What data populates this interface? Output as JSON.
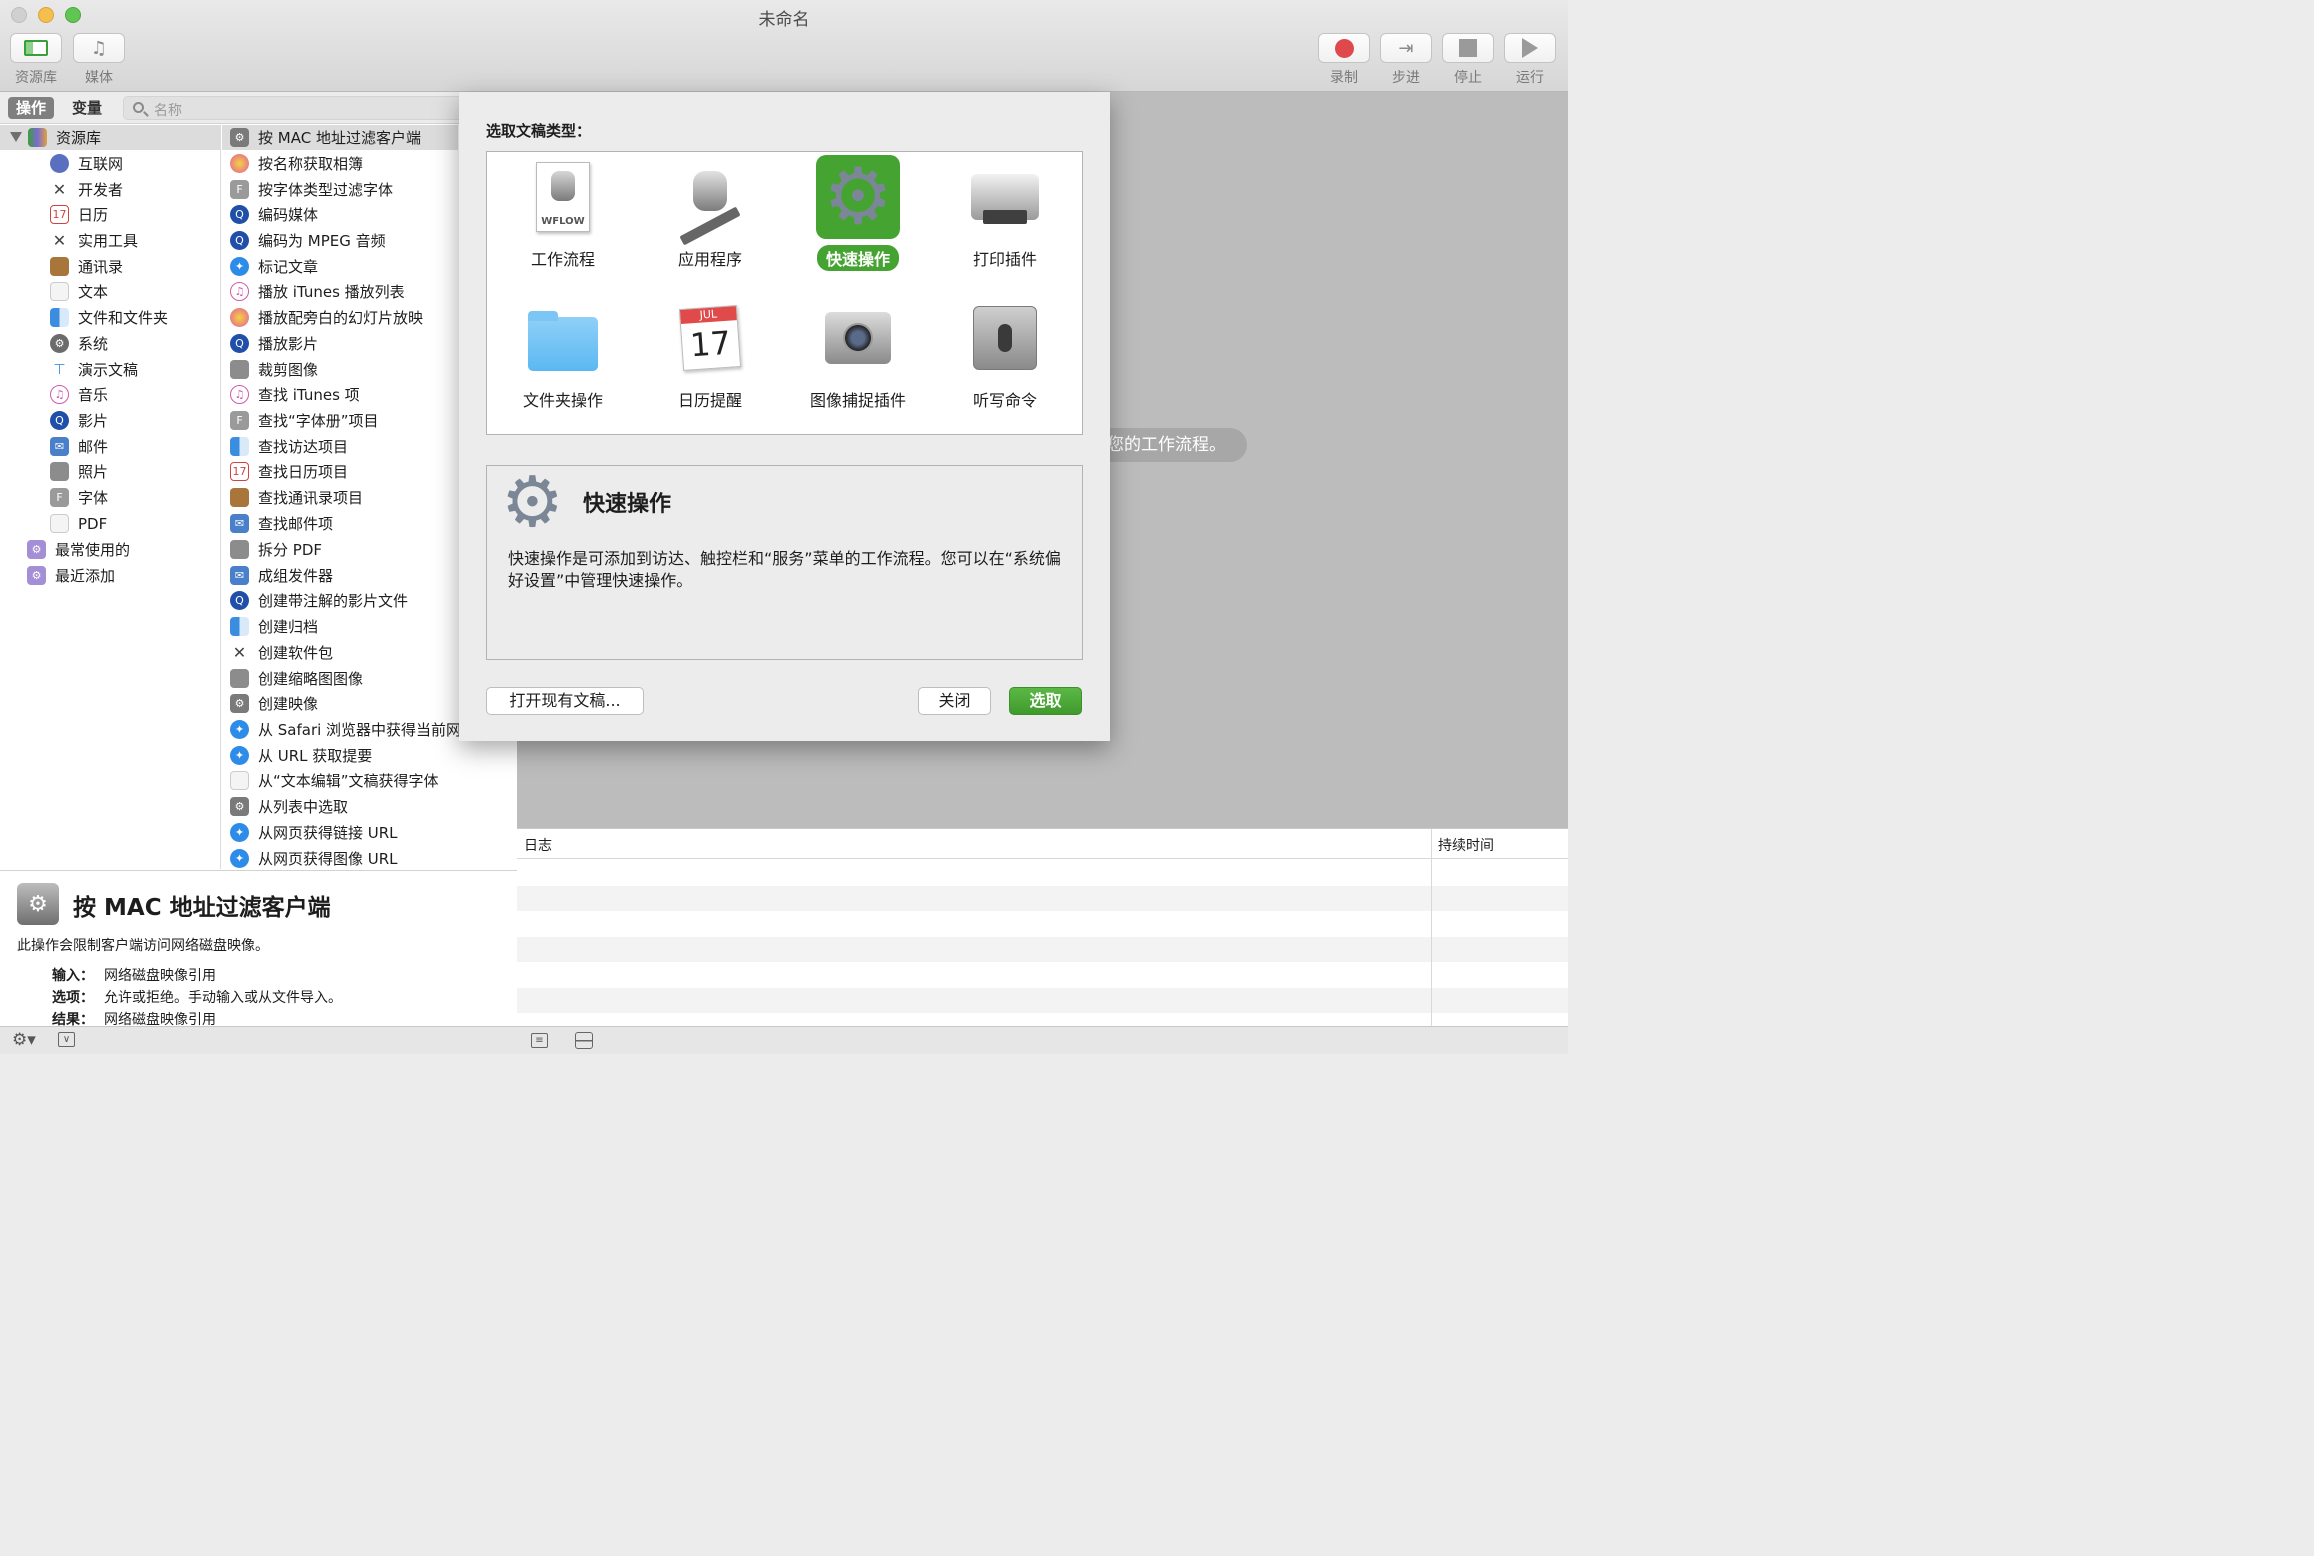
{
  "window": {
    "title": "未命名"
  },
  "toolbar": {
    "left": [
      {
        "label": "资源库",
        "icon": "library-icon"
      },
      {
        "label": "媒体",
        "icon": "media-icon"
      }
    ],
    "right": [
      {
        "label": "录制",
        "icon": "record-icon"
      },
      {
        "label": "步进",
        "icon": "step-icon"
      },
      {
        "label": "停止",
        "icon": "stop-icon"
      },
      {
        "label": "运行",
        "icon": "run-icon"
      }
    ]
  },
  "segments": {
    "actions": "操作",
    "variables": "变量"
  },
  "search": {
    "placeholder": "名称"
  },
  "library": {
    "root": "资源库",
    "items": [
      "互联网",
      "开发者",
      "日历",
      "实用工具",
      "通讯录",
      "文本",
      "文件和文件夹",
      "系统",
      "演示文稿",
      "音乐",
      "影片",
      "邮件",
      "照片",
      "字体",
      "PDF"
    ],
    "smart": [
      "最常使用的",
      "最近添加"
    ]
  },
  "actions": [
    "按 MAC 地址过滤客户端",
    "按名称获取相簿",
    "按字体类型过滤字体",
    "编码媒体",
    "编码为 MPEG 音频",
    "标记文章",
    "播放 iTunes 播放列表",
    "播放配旁白的幻灯片放映",
    "播放影片",
    "裁剪图像",
    "查找 iTunes 项",
    "查找“字体册”项目",
    "查找访达项目",
    "查找日历项目",
    "查找通讯录项目",
    "查找邮件项",
    "拆分 PDF",
    "成组发件器",
    "创建带注解的影片文件",
    "创建归档",
    "创建软件包",
    "创建缩略图图像",
    "创建映像",
    "从 Safari 浏览器中获得当前网",
    "从 URL 获取提要",
    "从“文本编辑”文稿获得字体",
    "从列表中选取",
    "从网页获得链接 URL",
    "从网页获得图像 URL"
  ],
  "description": {
    "title": "按 MAC 地址过滤客户端",
    "text": "此操作会限制客户端访问网络磁盘映像。",
    "input_label": "输入：",
    "input_value": "网络磁盘映像引用",
    "options_label": "选项：",
    "options_value": "允许或拒绝。手动输入或从文件导入。",
    "result_label": "结果：",
    "result_value": "网络磁盘映像引用"
  },
  "workflow_hint": "您的工作流程。",
  "log": {
    "col_log": "日志",
    "col_duration": "持续时间"
  },
  "sheet": {
    "prompt": "选取文稿类型：",
    "types": [
      {
        "label": "工作流程",
        "icon": "workflow-document-icon",
        "badge": "WFLOW"
      },
      {
        "label": "应用程序",
        "icon": "application-robot-icon"
      },
      {
        "label": "快速操作",
        "icon": "gear-icon",
        "selected": true
      },
      {
        "label": "打印插件",
        "icon": "printer-icon"
      },
      {
        "label": "文件夹操作",
        "icon": "folder-icon"
      },
      {
        "label": "日历提醒",
        "icon": "calendar-icon",
        "month": "JUL",
        "day": "17"
      },
      {
        "label": "图像捕捉插件",
        "icon": "camera-icon"
      },
      {
        "label": "听写命令",
        "icon": "microphone-icon"
      }
    ],
    "info_title": "快速操作",
    "info_text": "快速操作是可添加到访达、触控栏和“服务”菜单的工作流程。您可以在“系统偏好设置”中管理快速操作。",
    "open_existing": "打开现有文稿...",
    "close": "关闭",
    "choose": "选取"
  },
  "colors": {
    "accent_green": "#45a331",
    "record_red": "#e0494c"
  }
}
